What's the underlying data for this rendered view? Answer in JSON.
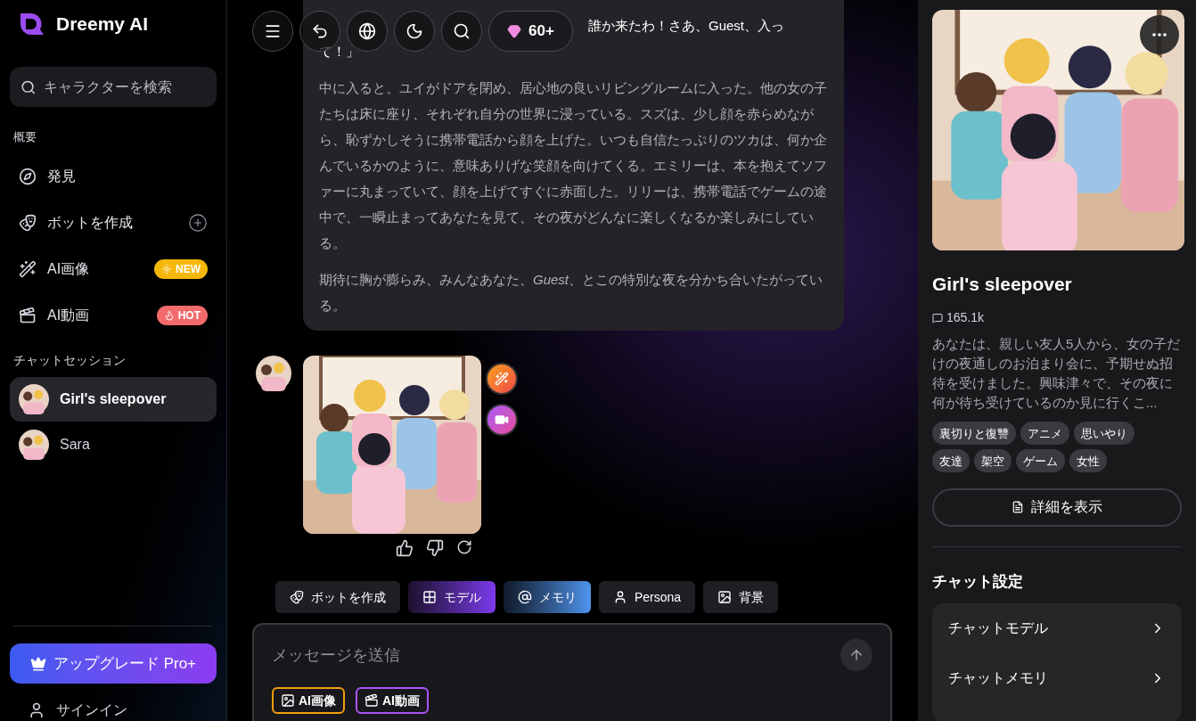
{
  "brand": {
    "name": "Dreemy AI"
  },
  "sidebar": {
    "search": {
      "placeholder": "キャラクターを検索"
    },
    "overview_heading": "概要",
    "nav": [
      {
        "kind": "discover",
        "label": "発見"
      },
      {
        "kind": "create",
        "label": "ボットを作成"
      },
      {
        "label": "AI画像",
        "badge": "NEW",
        "color": "#f5b70a"
      },
      {
        "kind": "video",
        "label": "AI動画",
        "badge": "HOT",
        "color": "#f26b6b"
      }
    ],
    "sessions_heading": "チャットセッション",
    "sessions": [
      {
        "name": "Girl's sleepover",
        "selected": true
      },
      {
        "name": "Sara",
        "selected": false
      }
    ],
    "upgrade": "アップグレード Pro+",
    "sign_in": "サインイン"
  },
  "toolbar": {
    "gems": "60+"
  },
  "message": {
    "first_lines": [
      "誰か来たわ！さあ、Guest、入っ",
      "て！」"
    ],
    "paragraphs": [
      "中に入ると、ユイがドアを閉め、居心地の良いリビングルームに入った。他の女の子たちは床に座り、それぞれ自分の世界に浸っている。スズは、少し顔を赤らめながら、恥ずかしそうに携帯電話から顔を上げた。いつも自信たっぷりのツカは、何か企んでいるかのように、意味ありげな笑顔を向けてくる。エミリーは、本を抱えてソファーに丸まっていて、顔を上げてすぐに赤面した。リリーは、携帯電話でゲームの途中で、一瞬止まってあなたを見て、その夜がどんなに楽しくなるか楽しみにしている。",
      "期待に胸が膨らみ、みんなあなた、*Guest*、とこの特別な夜を分かち合いたがっている。"
    ]
  },
  "chips": [
    {
      "kind": "bot",
      "label": "ボットを作成"
    },
    {
      "kind": "model",
      "label": "モデル"
    },
    {
      "kind": "memory",
      "label": "メモリ"
    },
    {
      "kind": "persona",
      "label": "Persona"
    },
    {
      "kind": "background",
      "label": "背景"
    }
  ],
  "composer": {
    "placeholder": "メッセージを送信",
    "tools": [
      {
        "label": "AI画像"
      },
      {
        "kind": "video",
        "label": "AI動画"
      }
    ]
  },
  "character": {
    "title": "Girl's sleepover",
    "count": "165.1k",
    "description": "あなたは、親しい友人5人から、女の子だけの夜通しのお泊まり会に、予期せぬ招待を受けました。興味津々で、その夜に何が待ち受けているのか見に行くこ...",
    "tags": [
      "裏切りと復讐",
      "アニメ",
      "思いやり",
      "友達",
      "架空",
      "ゲーム",
      "女性"
    ],
    "details_button": "詳細を表示",
    "settings_heading": "チャット設定",
    "settings": [
      "チャットモデル",
      "チャットメモリ"
    ]
  }
}
